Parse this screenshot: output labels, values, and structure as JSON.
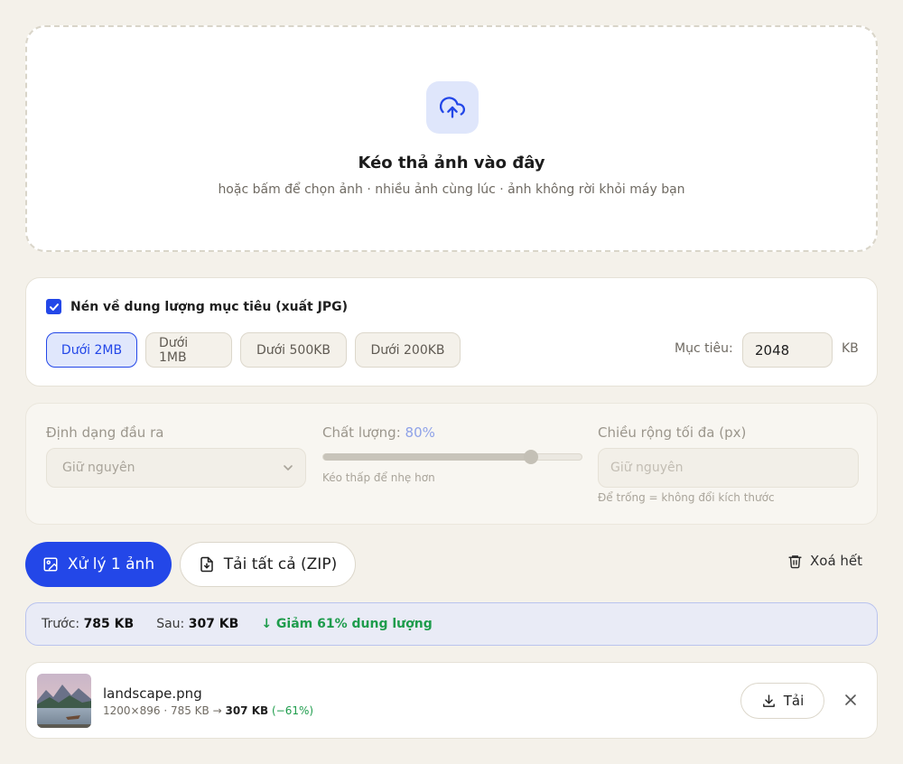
{
  "dropzone": {
    "icon": "cloud-upload-icon",
    "title": "Kéo thả ảnh vào đây",
    "subtitle": "hoặc bấm để chọn ảnh · nhiều ảnh cùng lúc · ảnh không rời khỏi máy bạn"
  },
  "compress": {
    "checked": true,
    "label": "Nén về dung lượng mục tiêu (xuất JPG)",
    "presets": [
      "Dưới 2MB",
      "Dưới 1MB",
      "Dưới 500KB",
      "Dưới 200KB"
    ],
    "active_preset": "Dưới 2MB",
    "target_label": "Mục tiêu:",
    "target_value": "2048",
    "target_unit": "KB"
  },
  "settings": {
    "format_label": "Định dạng đầu ra",
    "format_value": "Giữ nguyên",
    "quality_label": "Chất lượng:",
    "quality_value": "80%",
    "quality_fraction": 0.8,
    "quality_hint": "Kéo thấp để nhẹ hơn",
    "width_label": "Chiều rộng tối đa (px)",
    "width_placeholder": "Giữ nguyên",
    "width_hint": "Để trống = không đổi kích thước"
  },
  "actions": {
    "process_label": "Xử lý 1 ảnh",
    "download_all_label": "Tải tất cả (ZIP)",
    "clear_label": "Xoá hết"
  },
  "summary": {
    "before_label": "Trước:",
    "before_value": "785 KB",
    "after_label": "Sau:",
    "after_value": "307 KB",
    "reduction": "↓ Giảm 61% dung lượng"
  },
  "files": [
    {
      "name": "landscape.png",
      "meta": "1200×896 · 785 KB →",
      "new_size": "307 KB",
      "change": "(−61%)",
      "download_label": "Tải"
    }
  ],
  "colors": {
    "accent": "#2347e8",
    "success": "#1e9c4c",
    "background": "#f4f1ea"
  }
}
